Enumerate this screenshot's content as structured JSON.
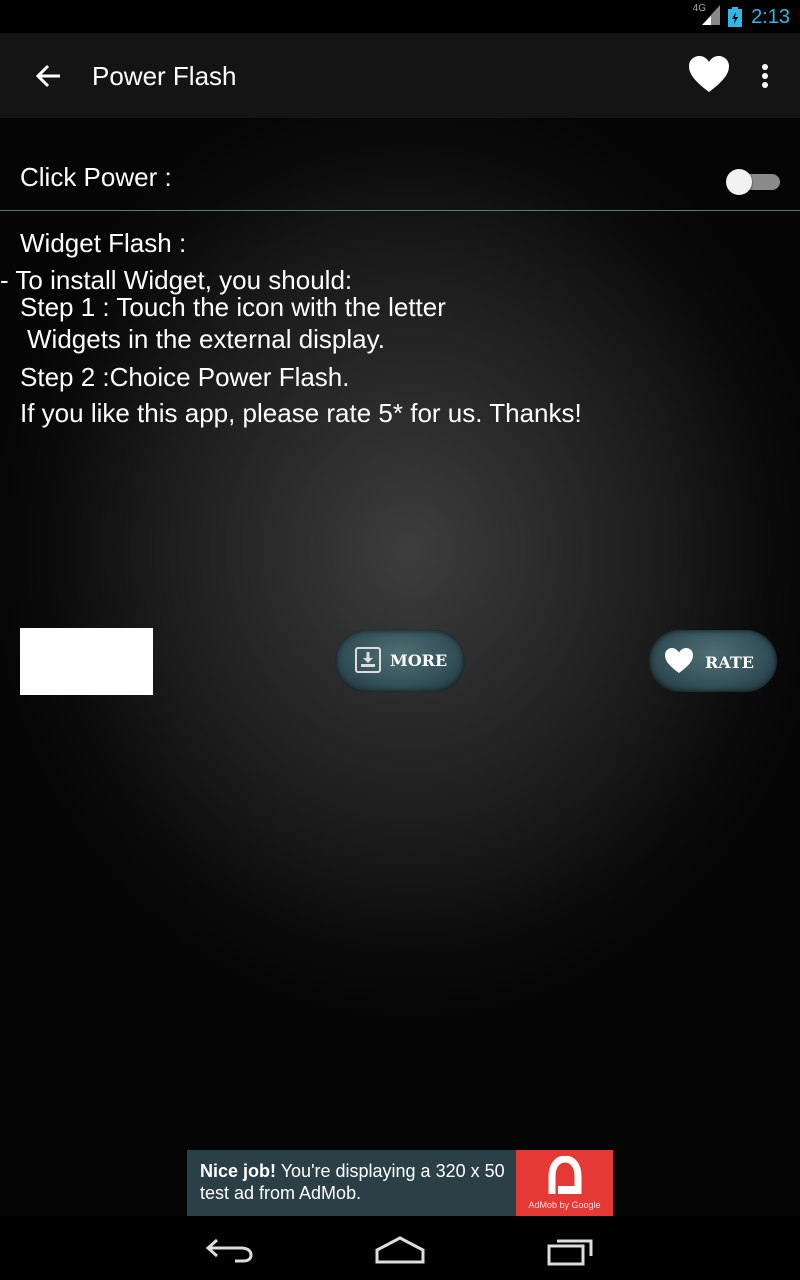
{
  "status_bar": {
    "network": "4G",
    "time": "2:13"
  },
  "action_bar": {
    "title": "Power Flash",
    "icons": [
      "back-arrow-icon",
      "heart-icon",
      "overflow-menu-icon"
    ]
  },
  "settings": {
    "click_power_label": "Click Power :",
    "click_power_enabled": false
  },
  "instructions": {
    "widget_heading": "Widget Flash :",
    "install_line": "- To install Widget, you should:",
    "step1_line1": "Step 1 : Touch the icon with the letter",
    "step1_line2": "Widgets in the external display.",
    "step2": "Step 2 :Choice Power Flash.",
    "rate_request": "If you like this app, please rate 5* for us. Thanks!"
  },
  "buttons": {
    "more_label": "MORE",
    "rate_label": "RATE"
  },
  "ad": {
    "headline": "Nice job!",
    "body": " You're displaying a 320 x 50 test ad from AdMob.",
    "badge": "AdMob by Google"
  },
  "colors": {
    "accent": "#33b5e5",
    "button": "#35525a",
    "ad_bg": "#2b3f47",
    "ad_logo": "#e53935"
  }
}
